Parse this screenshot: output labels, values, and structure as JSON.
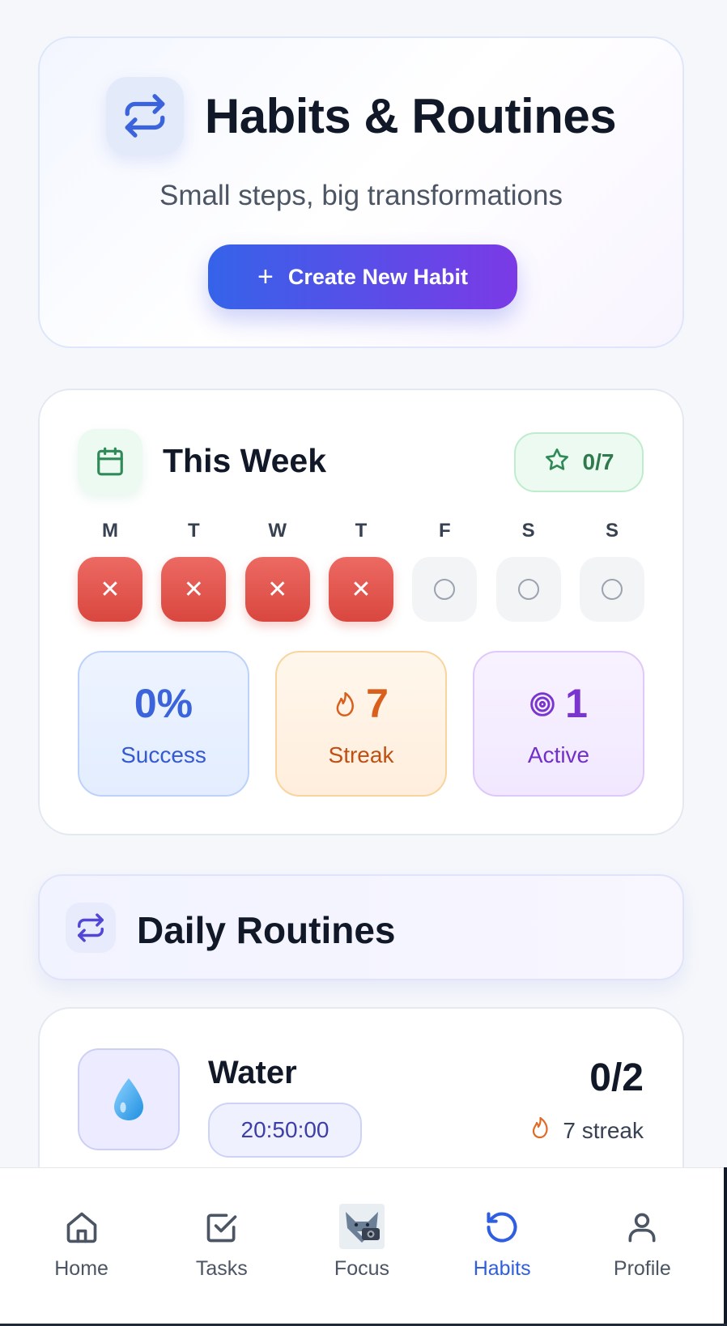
{
  "hero": {
    "title": "Habits & Routines",
    "subtitle": "Small steps, big transformations",
    "create_button": "Create New Habit"
  },
  "week": {
    "title": "This Week",
    "score": "0/7",
    "days": [
      {
        "letter": "M",
        "status": "missed"
      },
      {
        "letter": "T",
        "status": "missed"
      },
      {
        "letter": "W",
        "status": "missed"
      },
      {
        "letter": "T",
        "status": "missed"
      },
      {
        "letter": "F",
        "status": "pending"
      },
      {
        "letter": "S",
        "status": "pending"
      },
      {
        "letter": "S",
        "status": "pending"
      }
    ],
    "missed_glyph": "✕",
    "stats": {
      "success_value": "0%",
      "success_label": "Success",
      "streak_value": "7",
      "streak_label": "Streak",
      "active_value": "1",
      "active_label": "Active"
    }
  },
  "routines": {
    "title": "Daily Routines"
  },
  "habit": {
    "emoji": "💧",
    "name": "Water",
    "time": "20:50:00",
    "count": "0/2",
    "streak": "7 streak"
  },
  "nav": {
    "items": [
      {
        "label": "Home",
        "icon": "home-icon"
      },
      {
        "label": "Tasks",
        "icon": "checkbox-icon"
      },
      {
        "label": "Focus",
        "icon": "fox-camera-icon"
      },
      {
        "label": "Habits",
        "icon": "refresh-icon",
        "active": true
      },
      {
        "label": "Profile",
        "icon": "user-icon"
      }
    ]
  },
  "colors": {
    "accent": "#2f5fe0",
    "gradient_start": "#3563e9",
    "gradient_end": "#7b3ae6",
    "missed": "#e05850",
    "success": "#3a63dc",
    "streak": "#d8601c",
    "active": "#7a35cf"
  }
}
